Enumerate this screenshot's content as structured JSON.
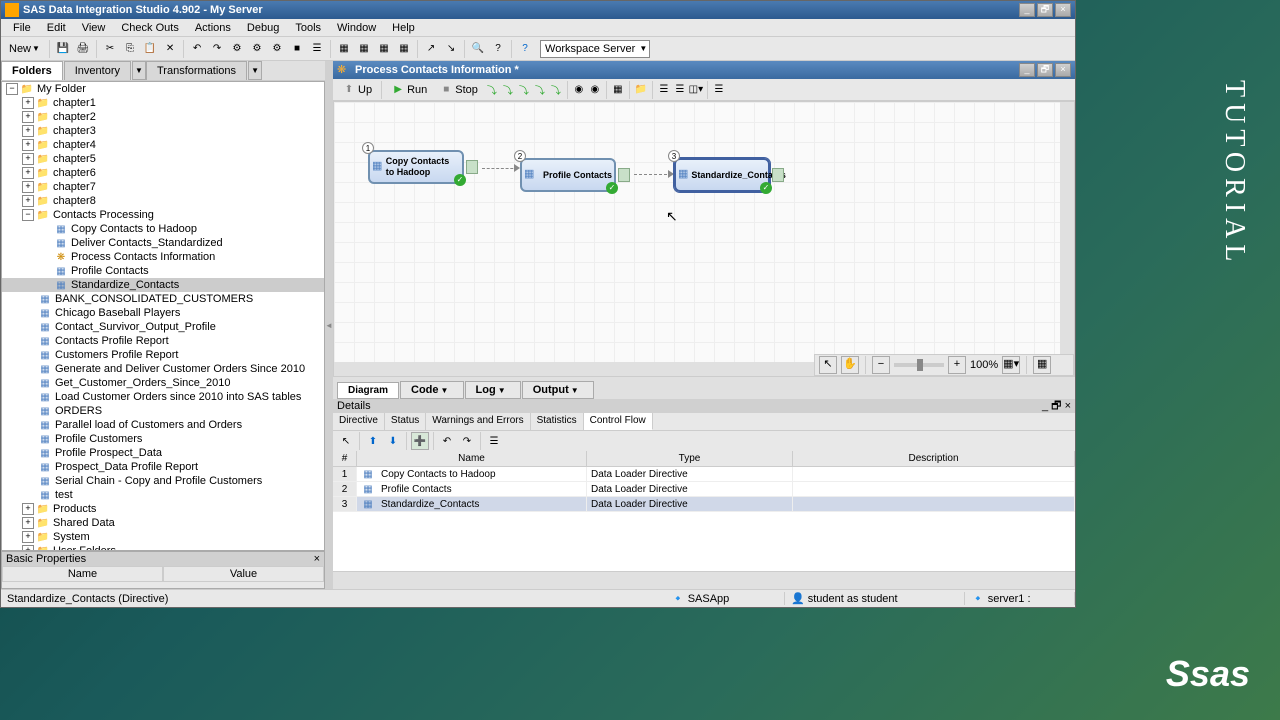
{
  "window": {
    "title": "SAS Data Integration Studio 4.902 - My Server",
    "min": "_",
    "max": "🗗",
    "close": "×"
  },
  "menu": [
    "File",
    "Edit",
    "View",
    "Check Outs",
    "Actions",
    "Debug",
    "Tools",
    "Window",
    "Help"
  ],
  "toolbar": {
    "new_label": "New",
    "workspace_server": "Workspace Server"
  },
  "left_tabs": {
    "folders": "Folders",
    "inventory": "Inventory",
    "transformations": "Transformations"
  },
  "tree": {
    "root": "My Folder",
    "chapters": [
      "chapter1",
      "chapter2",
      "chapter3",
      "chapter4",
      "chapter5",
      "chapter6",
      "chapter7",
      "chapter8"
    ],
    "contacts_folder": "Contacts Processing",
    "contacts_items": [
      "Copy Contacts to Hadoop",
      "Deliver Contacts_Standardized",
      "Process Contacts Information",
      "Profile Contacts",
      "Standardize_Contacts"
    ],
    "other_items": [
      "BANK_CONSOLIDATED_CUSTOMERS",
      "Chicago Baseball Players",
      "Contact_Survivor_Output_Profile",
      "Contacts Profile Report",
      "Customers Profile Report",
      "Generate and Deliver Customer Orders Since 2010",
      "Get_Customer_Orders_Since_2010",
      "Load Customer Orders since 2010 into SAS tables",
      "ORDERS",
      "Parallel load of Customers and Orders",
      "Profile Customers",
      "Profile Prospect_Data",
      "Prospect_Data Profile Report",
      "Serial Chain - Copy and Profile Customers",
      "test"
    ],
    "bottom_folders": [
      "Products",
      "Shared Data",
      "System",
      "User Folders"
    ]
  },
  "basic_props": {
    "title": "Basic Properties",
    "name_col": "Name",
    "value_col": "Value"
  },
  "editor": {
    "title": "Process Contacts Information *",
    "up": "Up",
    "run": "Run",
    "stop": "Stop",
    "nodes": [
      {
        "num": "1",
        "label": "Copy Contacts to Hadoop"
      },
      {
        "num": "2",
        "label": "Profile Contacts"
      },
      {
        "num": "3",
        "label": "Standardize_Contacts"
      }
    ],
    "zoom": "100%"
  },
  "view_tabs": {
    "diagram": "Diagram",
    "code": "Code",
    "log": "Log",
    "output": "Output"
  },
  "details": {
    "title": "Details",
    "tabs": [
      "Directive",
      "Status",
      "Warnings and Errors",
      "Statistics",
      "Control Flow"
    ],
    "cols": {
      "num": "#",
      "name": "Name",
      "type": "Type",
      "desc": "Description"
    },
    "rows": [
      {
        "n": "1",
        "name": "Copy Contacts to Hadoop",
        "type": "Data Loader Directive",
        "desc": ""
      },
      {
        "n": "2",
        "name": "Profile Contacts",
        "type": "Data Loader Directive",
        "desc": ""
      },
      {
        "n": "3",
        "name": "Standardize_Contacts",
        "type": "Data Loader Directive",
        "desc": ""
      }
    ]
  },
  "status": {
    "left": "Standardize_Contacts (Directive)",
    "app": "SASApp",
    "user": "student as student",
    "server": "server1 :"
  },
  "branding": {
    "tutorial": "TUTORIAL",
    "logo": "Ssas"
  }
}
